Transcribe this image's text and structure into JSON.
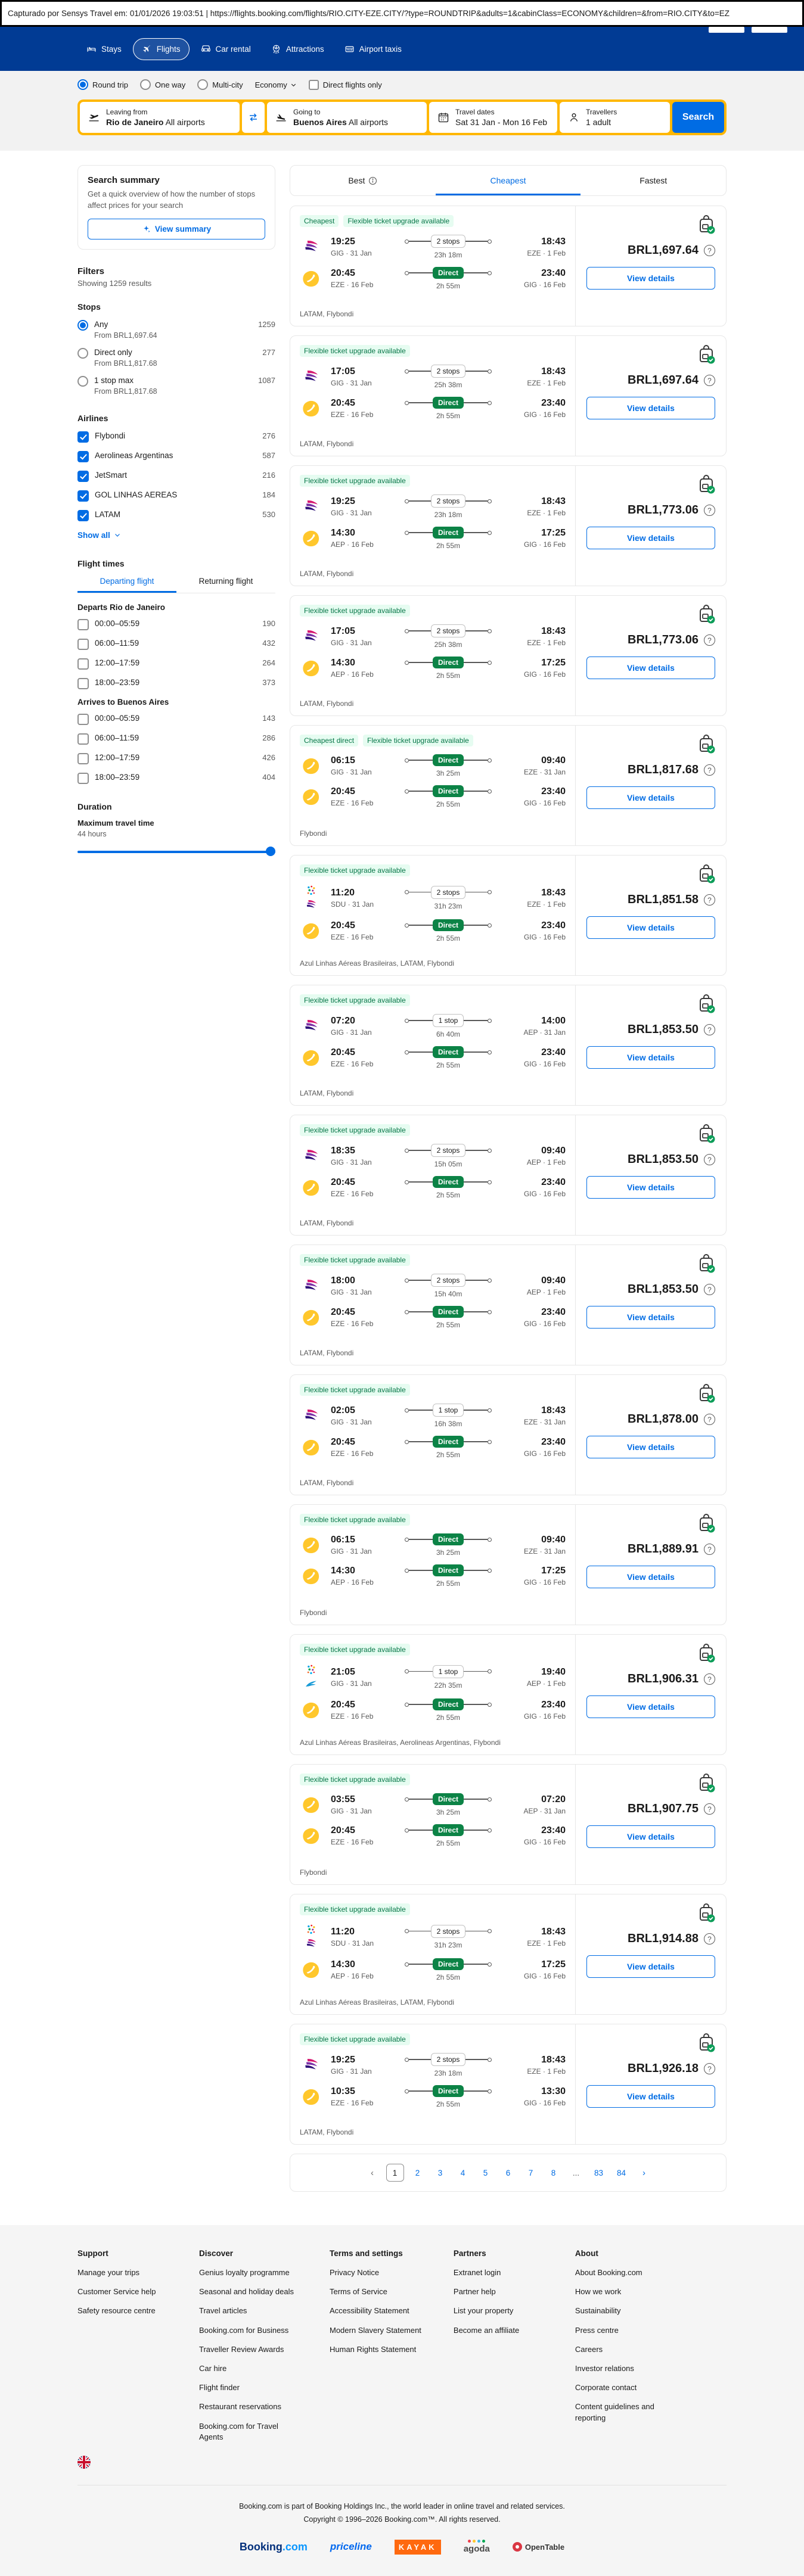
{
  "capture_bar": {
    "text": "Capturado por Sensys Travel em: 01/01/2026 19:03:51  |  https://flights.booking.com/flights/RIO.CITY-EZE.CITY/?type=ROUNDTRIP&adults=1&cabinClass=ECONOMY&children=&from=RIO.CITY&to=EZ"
  },
  "header": {
    "nav": [
      {
        "label": "Stays",
        "icon": "bed-icon",
        "active": false
      },
      {
        "label": "Flights",
        "icon": "plane-icon",
        "active": true
      },
      {
        "label": "Car rental",
        "icon": "car-icon",
        "active": false
      },
      {
        "label": "Attractions",
        "icon": "attractions-icon",
        "active": false
      },
      {
        "label": "Airport taxis",
        "icon": "taxi-icon",
        "active": false
      }
    ]
  },
  "search_form": {
    "trip_types": [
      {
        "label": "Round trip",
        "selected": true
      },
      {
        "label": "One way",
        "selected": false
      },
      {
        "label": "Multi-city",
        "selected": false
      }
    ],
    "cabin_class": "Economy",
    "direct_only_label": "Direct flights only",
    "leaving_from": {
      "label": "Leaving from",
      "value": "Rio de Janeiro",
      "suffix": "All airports"
    },
    "going_to": {
      "label": "Going to",
      "value": "Buenos Aires",
      "suffix": "All airports"
    },
    "travel_dates": {
      "label": "Travel dates",
      "value": "Sat 31 Jan - Mon 16 Feb"
    },
    "travellers": {
      "label": "Travellers",
      "value": "1 adult"
    },
    "search_label": "Search"
  },
  "sidebar": {
    "summary": {
      "title": "Search summary",
      "description": "Get a quick overview of how the number of stops affect prices for your search",
      "button_label": "View summary"
    },
    "filters_title": "Filters",
    "results_count_text": "Showing 1259 results",
    "stops": {
      "title": "Stops",
      "options": [
        {
          "label": "Any",
          "count": "1259",
          "from": "From BRL1,697.64",
          "selected": true
        },
        {
          "label": "Direct only",
          "count": "277",
          "from": "From BRL1,817.68",
          "selected": false
        },
        {
          "label": "1 stop max",
          "count": "1087",
          "from": "From BRL1,817.68",
          "selected": false
        }
      ]
    },
    "airlines": {
      "title": "Airlines",
      "show_all_label": "Show all",
      "options": [
        {
          "label": "Flybondi",
          "count": "276",
          "checked": true
        },
        {
          "label": "Aerolineas Argentinas",
          "count": "587",
          "checked": true
        },
        {
          "label": "JetSmart",
          "count": "216",
          "checked": true
        },
        {
          "label": "GOL LINHAS AEREAS",
          "count": "184",
          "checked": true
        },
        {
          "label": "LATAM",
          "count": "530",
          "checked": true
        }
      ]
    },
    "flight_times": {
      "title": "Flight times",
      "tabs": [
        {
          "label": "Departing flight",
          "active": true
        },
        {
          "label": "Returning flight",
          "active": false
        }
      ],
      "groups": [
        {
          "heading": "Departs Rio de Janeiro",
          "slots": [
            {
              "label": "00:00–05:59",
              "count": "190"
            },
            {
              "label": "06:00–11:59",
              "count": "432"
            },
            {
              "label": "12:00–17:59",
              "count": "264"
            },
            {
              "label": "18:00–23:59",
              "count": "373"
            }
          ]
        },
        {
          "heading": "Arrives to Buenos Aires",
          "slots": [
            {
              "label": "00:00–05:59",
              "count": "143"
            },
            {
              "label": "06:00–11:59",
              "count": "286"
            },
            {
              "label": "12:00–17:59",
              "count": "426"
            },
            {
              "label": "18:00–23:59",
              "count": "404"
            }
          ]
        }
      ]
    },
    "duration": {
      "title": "Duration",
      "subtitle": "Maximum travel time",
      "value": "44 hours"
    }
  },
  "results": {
    "tabs": [
      {
        "label": "Best",
        "info_icon": true,
        "active": false
      },
      {
        "label": "Cheapest",
        "info_icon": false,
        "active": true
      },
      {
        "label": "Fastest",
        "info_icon": false,
        "active": false
      }
    ],
    "view_details_label": "View details",
    "flights": [
      {
        "badges": [
          "Cheapest",
          "Flexible ticket upgrade available"
        ],
        "legs": [
          {
            "logos": [
              "latam"
            ],
            "dep_time": "19:25",
            "dep_info": "GIG · 31 Jan",
            "stops": "2 stops",
            "duration": "23h 18m",
            "arr_time": "18:43",
            "arr_info": "EZE · 1 Feb"
          },
          {
            "logos": [
              "flybondi"
            ],
            "dep_time": "20:45",
            "dep_info": "EZE · 16 Feb",
            "stops": "Direct",
            "duration": "2h 55m",
            "arr_time": "23:40",
            "arr_info": "GIG · 16 Feb"
          }
        ],
        "airlines": "LATAM, Flybondi",
        "price": "BRL1,697.64"
      },
      {
        "badges": [
          "Flexible ticket upgrade available"
        ],
        "legs": [
          {
            "logos": [
              "latam"
            ],
            "dep_time": "17:05",
            "dep_info": "GIG · 31 Jan",
            "stops": "2 stops",
            "duration": "25h 38m",
            "arr_time": "18:43",
            "arr_info": "EZE · 1 Feb"
          },
          {
            "logos": [
              "flybondi"
            ],
            "dep_time": "20:45",
            "dep_info": "EZE · 16 Feb",
            "stops": "Direct",
            "duration": "2h 55m",
            "arr_time": "23:40",
            "arr_info": "GIG · 16 Feb"
          }
        ],
        "airlines": "LATAM, Flybondi",
        "price": "BRL1,697.64"
      },
      {
        "badges": [
          "Flexible ticket upgrade available"
        ],
        "legs": [
          {
            "logos": [
              "latam"
            ],
            "dep_time": "19:25",
            "dep_info": "GIG · 31 Jan",
            "stops": "2 stops",
            "duration": "23h 18m",
            "arr_time": "18:43",
            "arr_info": "EZE · 1 Feb"
          },
          {
            "logos": [
              "flybondi"
            ],
            "dep_time": "14:30",
            "dep_info": "AEP · 16 Feb",
            "stops": "Direct",
            "duration": "2h 55m",
            "arr_time": "17:25",
            "arr_info": "GIG · 16 Feb"
          }
        ],
        "airlines": "LATAM, Flybondi",
        "price": "BRL1,773.06"
      },
      {
        "badges": [
          "Flexible ticket upgrade available"
        ],
        "legs": [
          {
            "logos": [
              "latam"
            ],
            "dep_time": "17:05",
            "dep_info": "GIG · 31 Jan",
            "stops": "2 stops",
            "duration": "25h 38m",
            "arr_time": "18:43",
            "arr_info": "EZE · 1 Feb"
          },
          {
            "logos": [
              "flybondi"
            ],
            "dep_time": "14:30",
            "dep_info": "AEP · 16 Feb",
            "stops": "Direct",
            "duration": "2h 55m",
            "arr_time": "17:25",
            "arr_info": "GIG · 16 Feb"
          }
        ],
        "airlines": "LATAM, Flybondi",
        "price": "BRL1,773.06"
      },
      {
        "badges": [
          "Cheapest direct",
          "Flexible ticket upgrade available"
        ],
        "legs": [
          {
            "logos": [
              "flybondi"
            ],
            "dep_time": "06:15",
            "dep_info": "GIG · 31 Jan",
            "stops": "Direct",
            "duration": "3h 25m",
            "arr_time": "09:40",
            "arr_info": "EZE · 31 Jan"
          },
          {
            "logos": [
              "flybondi"
            ],
            "dep_time": "20:45",
            "dep_info": "EZE · 16 Feb",
            "stops": "Direct",
            "duration": "2h 55m",
            "arr_time": "23:40",
            "arr_info": "GIG · 16 Feb"
          }
        ],
        "airlines": "Flybondi",
        "price": "BRL1,817.68"
      },
      {
        "badges": [
          "Flexible ticket upgrade available"
        ],
        "legs": [
          {
            "logos": [
              "azul",
              "latam"
            ],
            "dep_time": "11:20",
            "dep_info": "SDU · 31 Jan",
            "stops": "2 stops",
            "duration": "31h 23m",
            "arr_time": "18:43",
            "arr_info": "EZE · 1 Feb"
          },
          {
            "logos": [
              "flybondi"
            ],
            "dep_time": "20:45",
            "dep_info": "EZE · 16 Feb",
            "stops": "Direct",
            "duration": "2h 55m",
            "arr_time": "23:40",
            "arr_info": "GIG · 16 Feb"
          }
        ],
        "airlines": "Azul Linhas Aéreas Brasileiras, LATAM, Flybondi",
        "price": "BRL1,851.58"
      },
      {
        "badges": [
          "Flexible ticket upgrade available"
        ],
        "legs": [
          {
            "logos": [
              "latam"
            ],
            "dep_time": "07:20",
            "dep_info": "GIG · 31 Jan",
            "stops": "1 stop",
            "duration": "6h 40m",
            "arr_time": "14:00",
            "arr_info": "AEP · 31 Jan"
          },
          {
            "logos": [
              "flybondi"
            ],
            "dep_time": "20:45",
            "dep_info": "EZE · 16 Feb",
            "stops": "Direct",
            "duration": "2h 55m",
            "arr_time": "23:40",
            "arr_info": "GIG · 16 Feb"
          }
        ],
        "airlines": "LATAM, Flybondi",
        "price": "BRL1,853.50"
      },
      {
        "badges": [
          "Flexible ticket upgrade available"
        ],
        "legs": [
          {
            "logos": [
              "latam"
            ],
            "dep_time": "18:35",
            "dep_info": "GIG · 31 Jan",
            "stops": "2 stops",
            "duration": "15h 05m",
            "arr_time": "09:40",
            "arr_info": "AEP · 1 Feb"
          },
          {
            "logos": [
              "flybondi"
            ],
            "dep_time": "20:45",
            "dep_info": "EZE · 16 Feb",
            "stops": "Direct",
            "duration": "2h 55m",
            "arr_time": "23:40",
            "arr_info": "GIG · 16 Feb"
          }
        ],
        "airlines": "LATAM, Flybondi",
        "price": "BRL1,853.50"
      },
      {
        "badges": [
          "Flexible ticket upgrade available"
        ],
        "legs": [
          {
            "logos": [
              "latam"
            ],
            "dep_time": "18:00",
            "dep_info": "GIG · 31 Jan",
            "stops": "2 stops",
            "duration": "15h 40m",
            "arr_time": "09:40",
            "arr_info": "AEP · 1 Feb"
          },
          {
            "logos": [
              "flybondi"
            ],
            "dep_time": "20:45",
            "dep_info": "EZE · 16 Feb",
            "stops": "Direct",
            "duration": "2h 55m",
            "arr_time": "23:40",
            "arr_info": "GIG · 16 Feb"
          }
        ],
        "airlines": "LATAM, Flybondi",
        "price": "BRL1,853.50"
      },
      {
        "badges": [
          "Flexible ticket upgrade available"
        ],
        "legs": [
          {
            "logos": [
              "latam"
            ],
            "dep_time": "02:05",
            "dep_info": "GIG · 31 Jan",
            "stops": "1 stop",
            "duration": "16h 38m",
            "arr_time": "18:43",
            "arr_info": "EZE · 31 Jan"
          },
          {
            "logos": [
              "flybondi"
            ],
            "dep_time": "20:45",
            "dep_info": "EZE · 16 Feb",
            "stops": "Direct",
            "duration": "2h 55m",
            "arr_time": "23:40",
            "arr_info": "GIG · 16 Feb"
          }
        ],
        "airlines": "LATAM, Flybondi",
        "price": "BRL1,878.00"
      },
      {
        "badges": [
          "Flexible ticket upgrade available"
        ],
        "legs": [
          {
            "logos": [
              "flybondi"
            ],
            "dep_time": "06:15",
            "dep_info": "GIG · 31 Jan",
            "stops": "Direct",
            "duration": "3h 25m",
            "arr_time": "09:40",
            "arr_info": "EZE · 31 Jan"
          },
          {
            "logos": [
              "flybondi"
            ],
            "dep_time": "14:30",
            "dep_info": "AEP · 16 Feb",
            "stops": "Direct",
            "duration": "2h 55m",
            "arr_time": "17:25",
            "arr_info": "GIG · 16 Feb"
          }
        ],
        "airlines": "Flybondi",
        "price": "BRL1,889.91"
      },
      {
        "badges": [
          "Flexible ticket upgrade available"
        ],
        "legs": [
          {
            "logos": [
              "azul",
              "aerolineas"
            ],
            "dep_time": "21:05",
            "dep_info": "GIG · 31 Jan",
            "stops": "1 stop",
            "duration": "22h 35m",
            "arr_time": "19:40",
            "arr_info": "AEP · 1 Feb"
          },
          {
            "logos": [
              "flybondi"
            ],
            "dep_time": "20:45",
            "dep_info": "EZE · 16 Feb",
            "stops": "Direct",
            "duration": "2h 55m",
            "arr_time": "23:40",
            "arr_info": "GIG · 16 Feb"
          }
        ],
        "airlines": "Azul Linhas Aéreas Brasileiras, Aerolineas Argentinas, Flybondi",
        "price": "BRL1,906.31"
      },
      {
        "badges": [
          "Flexible ticket upgrade available"
        ],
        "legs": [
          {
            "logos": [
              "flybondi"
            ],
            "dep_time": "03:55",
            "dep_info": "GIG · 31 Jan",
            "stops": "Direct",
            "duration": "3h 25m",
            "arr_time": "07:20",
            "arr_info": "AEP · 31 Jan"
          },
          {
            "logos": [
              "flybondi"
            ],
            "dep_time": "20:45",
            "dep_info": "EZE · 16 Feb",
            "stops": "Direct",
            "duration": "2h 55m",
            "arr_time": "23:40",
            "arr_info": "GIG · 16 Feb"
          }
        ],
        "airlines": "Flybondi",
        "price": "BRL1,907.75"
      },
      {
        "badges": [
          "Flexible ticket upgrade available"
        ],
        "legs": [
          {
            "logos": [
              "azul",
              "latam"
            ],
            "dep_time": "11:20",
            "dep_info": "SDU · 31 Jan",
            "stops": "2 stops",
            "duration": "31h 23m",
            "arr_time": "18:43",
            "arr_info": "EZE · 1 Feb"
          },
          {
            "logos": [
              "flybondi"
            ],
            "dep_time": "14:30",
            "dep_info": "AEP · 16 Feb",
            "stops": "Direct",
            "duration": "2h 55m",
            "arr_time": "17:25",
            "arr_info": "GIG · 16 Feb"
          }
        ],
        "airlines": "Azul Linhas Aéreas Brasileiras, LATAM, Flybondi",
        "price": "BRL1,914.88"
      },
      {
        "badges": [
          "Flexible ticket upgrade available"
        ],
        "legs": [
          {
            "logos": [
              "latam"
            ],
            "dep_time": "19:25",
            "dep_info": "GIG · 31 Jan",
            "stops": "2 stops",
            "duration": "23h 18m",
            "arr_time": "18:43",
            "arr_info": "EZE · 1 Feb"
          },
          {
            "logos": [
              "flybondi"
            ],
            "dep_time": "10:35",
            "dep_info": "EZE · 16 Feb",
            "stops": "Direct",
            "duration": "2h 55m",
            "arr_time": "13:30",
            "arr_info": "GIG · 16 Feb"
          }
        ],
        "airlines": "LATAM, Flybondi",
        "price": "BRL1,926.18"
      }
    ],
    "pagination": {
      "prev": "‹",
      "next": "›",
      "current": "1",
      "pages": [
        "1",
        "2",
        "3",
        "4",
        "5",
        "6",
        "7",
        "8",
        "...",
        "83",
        "84"
      ]
    }
  },
  "footer": {
    "columns": [
      {
        "title": "Support",
        "links": [
          "Manage your trips",
          "Customer Service help",
          "Safety resource centre"
        ]
      },
      {
        "title": "Discover",
        "links": [
          "Genius loyalty programme",
          "Seasonal and holiday deals",
          "Travel articles",
          "Booking.com for Business",
          "Traveller Review Awards",
          "Car hire",
          "Flight finder",
          "Restaurant reservations",
          "Booking.com for Travel Agents"
        ]
      },
      {
        "title": "Terms and settings",
        "links": [
          "Privacy Notice",
          "Terms of Service",
          "Accessibility Statement",
          "Modern Slavery Statement",
          "Human Rights Statement"
        ]
      },
      {
        "title": "Partners",
        "links": [
          "Extranet login",
          "Partner help",
          "List your property",
          "Become an affiliate"
        ]
      },
      {
        "title": "About",
        "links": [
          "About Booking.com",
          "How we work",
          "Sustainability",
          "Press centre",
          "Careers",
          "Investor relations",
          "Corporate contact",
          "Content guidelines and reporting"
        ]
      }
    ],
    "legal_line1": "Booking.com is part of Booking Holdings Inc., the world leader in online travel and related services.",
    "legal_line2": "Copyright © 1996–2026 Booking.com™. All rights reserved.",
    "brands": [
      "Booking.com",
      "priceline",
      "KAYAK",
      "agoda",
      "OpenTable"
    ]
  },
  "colors": {
    "header_blue": "#013b94",
    "accent_blue": "#006ce4",
    "search_yellow": "#ffb700",
    "direct_green": "#0c8346",
    "badge_green_bg": "#e6fcf1",
    "badge_green_text": "#067647"
  }
}
